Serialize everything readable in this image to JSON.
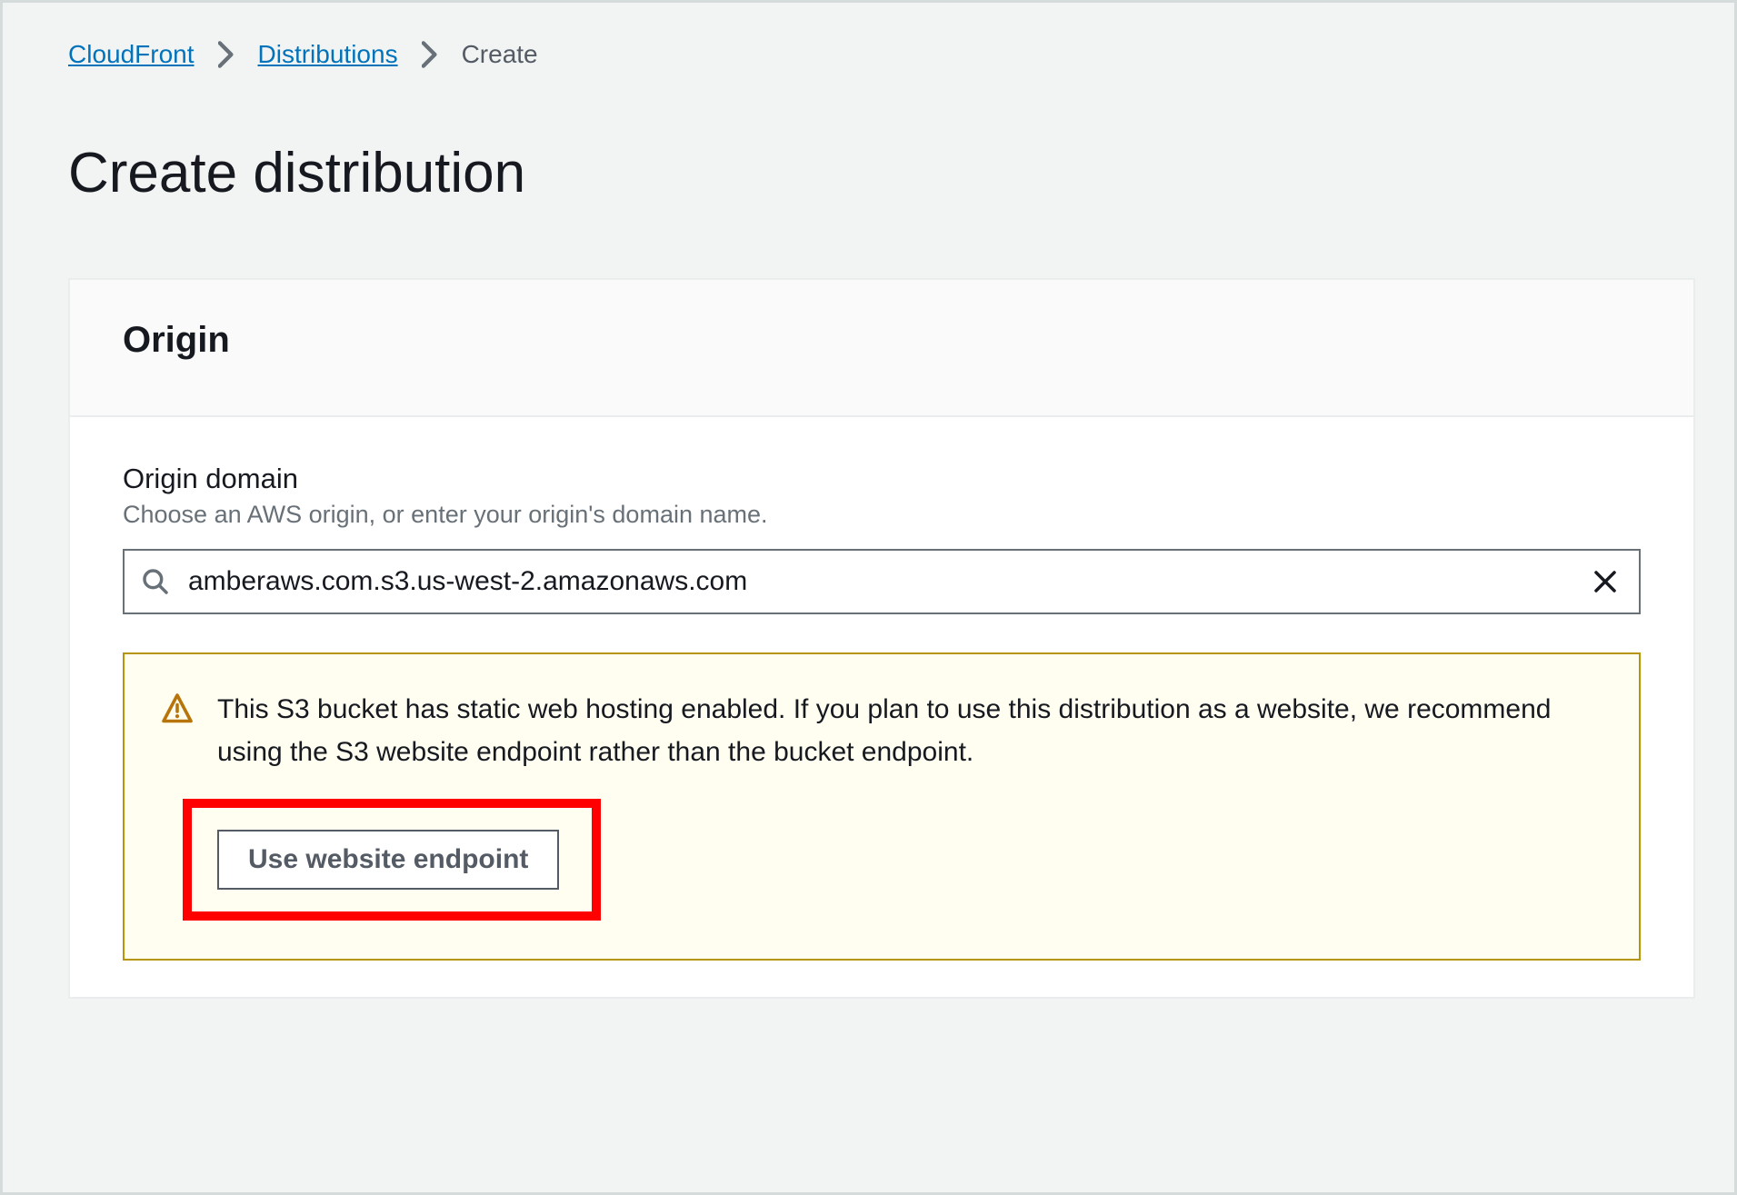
{
  "breadcrumb": {
    "items": [
      {
        "label": "CloudFront",
        "link": true
      },
      {
        "label": "Distributions",
        "link": true
      },
      {
        "label": "Create",
        "link": false
      }
    ]
  },
  "page": {
    "title": "Create distribution"
  },
  "panel": {
    "heading": "Origin",
    "origin_domain": {
      "label": "Origin domain",
      "hint": "Choose an AWS origin, or enter your origin's domain name.",
      "value": "amberaws.com.s3.us-west-2.amazonaws.com"
    },
    "alert": {
      "text": "This S3 bucket has static web hosting enabled. If you plan to use this distribution as a website, we recommend using the S3 website endpoint rather than the bucket endpoint.",
      "action_label": "Use website endpoint"
    }
  }
}
